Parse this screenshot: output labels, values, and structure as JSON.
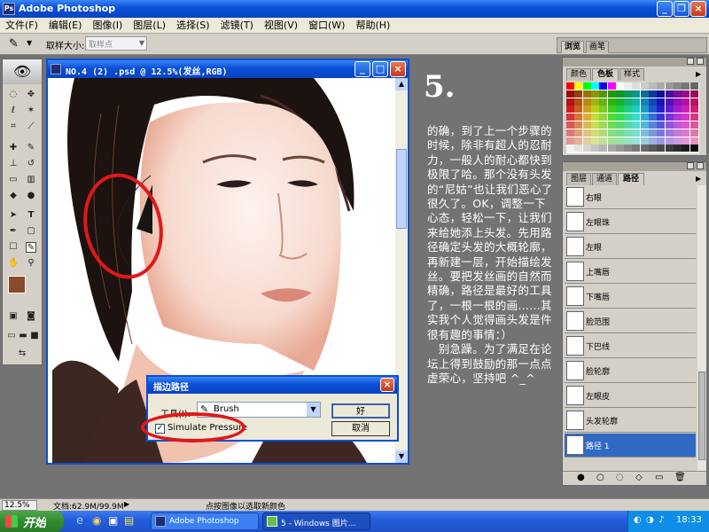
{
  "app": {
    "title": "Adobe Photoshop"
  },
  "menu": [
    "文件(F)",
    "编辑(E)",
    "图像(I)",
    "图层(L)",
    "选择(S)",
    "滤镜(T)",
    "视图(V)",
    "窗口(W)",
    "帮助(H)"
  ],
  "options": {
    "sample_label": "取样大小:",
    "sample_value": "取样点"
  },
  "palette_well_tabs": [
    "浏览",
    "画笔"
  ],
  "document": {
    "title": "NO.4 (2) .psd @ 12.5%(发丝,RGB)"
  },
  "tutorial": {
    "heading": "5.",
    "text": "的确，到了上一个步骤的时候，除非有超人的忍耐力，一般人的耐心都快到极限了哈。那个没有头发的“尼姑”也让我们恶心了很久了。OK，调整一下心态，轻松一下，让我们来给她添上头发。先用路径确定头发的大概轮廓，再新建一层，开始描绘发丝。要把发丝画的自然而精确，路径是最好的工具了，一根一根的画……其实我个人觉得画头发是件很有趣的事情：）\n　别急躁。为了满足在论坛上得到鼓励的那一点点虚荣心，坚持吧 ^_^"
  },
  "color_panel": {
    "tabs": [
      "颜色",
      "色板",
      "样式"
    ],
    "active": "色板"
  },
  "paths_panel": {
    "tabs": [
      "图层",
      "通道",
      "路径"
    ],
    "active": "路径",
    "items": [
      "右眼",
      "左眼珠",
      "左眼",
      "上嘴唇",
      "下嘴唇",
      "脸范围",
      "下巴线",
      "脸轮廓",
      "左眼皮",
      "头发轮廓",
      "路径 1"
    ],
    "selected": "路径 1"
  },
  "dialog": {
    "title": "描边路径",
    "tool_label": "工具(I):",
    "tool_value": "Brush",
    "checkbox_label": "Simulate Pressure",
    "checkbox_checked": true,
    "ok": "好",
    "cancel": "取消"
  },
  "status": {
    "zoom": "12.5%",
    "doc": "文档:62.9M/99.9M",
    "hint": "点按图像以选取新颜色"
  },
  "taskbar": {
    "start": "开始",
    "tasks": [
      "Adobe Photoshop",
      "5 - Windows 图片..."
    ],
    "time": "18:33"
  },
  "colors": {
    "foreground": "#8b4a2a",
    "background": "#000000",
    "accent_red": "#e01818",
    "selection": "#316ac5"
  }
}
